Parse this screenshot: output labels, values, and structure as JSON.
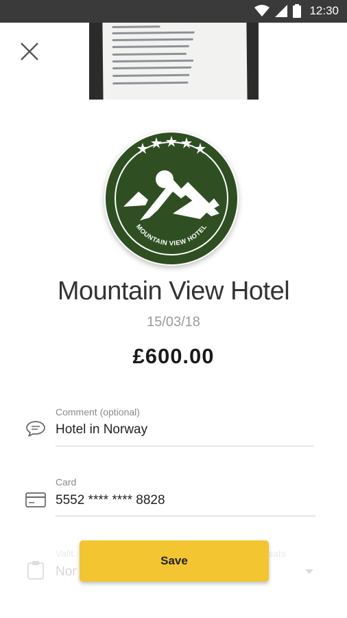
{
  "status_bar": {
    "time": "12:30"
  },
  "merchant": {
    "name": "Mountain View Hotel",
    "logo_text": "MOUNTAIN VIEW HOTEL",
    "logo_color": "#2f4f23"
  },
  "transaction": {
    "date": "15/03/18",
    "amount": "£600.00"
  },
  "fields": {
    "comment": {
      "label": "Comment (optional)",
      "value": "Hotel in Norway"
    },
    "card": {
      "label": "Card",
      "value": "5552 **** **** 8828"
    },
    "third": {
      "label_left": "Valit",
      "label_right": "sats",
      "value": "Nor"
    }
  },
  "actions": {
    "save_label": "Save",
    "accent": "#f3c531"
  }
}
